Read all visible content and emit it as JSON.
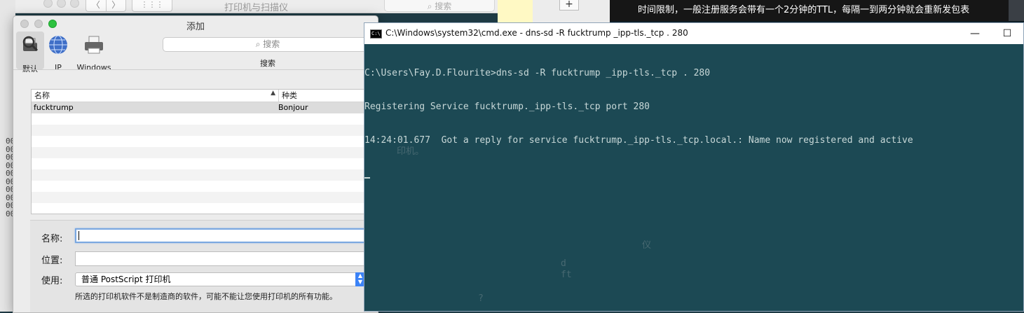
{
  "background": {
    "printers_window_title": "打印机与扫描仪",
    "printers_search_placeholder": "搜索",
    "nav_back": "〈",
    "nav_forward": "〉",
    "plus_button": "+",
    "left_gutter_lines": [
      "00",
      "00",
      "00",
      "00",
      "00",
      "00",
      "00",
      "00",
      "00",
      "00"
    ],
    "banner_text": "时间限制，一般注册服务会带有一个2分钟的TTL，每隔一到两分钟就会重新发包表",
    "ghost_text_1": "印机。",
    "ghost_text_2": "仪",
    "ghost_text_3": "d",
    "ghost_text_4": "ft",
    "ghost_text_5": "?"
  },
  "dialog": {
    "title": "添加",
    "toolbar": [
      {
        "label": "默认",
        "icon": "default-printer-icon"
      },
      {
        "label": "IP",
        "icon": "globe-icon"
      },
      {
        "label": "Windows",
        "icon": "windows-printer-icon"
      }
    ],
    "search_placeholder": "搜索",
    "search_caption": "搜索",
    "table": {
      "headers": [
        "名称",
        "种类"
      ],
      "rows": [
        {
          "name": "fucktrump",
          "kind": "Bonjour"
        }
      ]
    },
    "form": {
      "name_label": "名称:",
      "name_value": "",
      "location_label": "位置:",
      "location_value": "",
      "use_label": "使用:",
      "use_value": "普通 PostScript 打印机",
      "note": "所选的打印机软件不是制造商的软件，可能不能让您使用打印机的所有功能。"
    }
  },
  "cmd": {
    "title": "C:\\Windows\\system32\\cmd.exe - dns-sd  -R fucktrump _ipp-tls._tcp . 280",
    "minimize": "—",
    "maximize": "☐",
    "lines": [
      "C:\\Users\\Fay.D.Flourite>dns-sd -R fucktrump _ipp-tls._tcp . 280",
      "Registering Service fucktrump._ipp-tls._tcp port 280",
      "14:24:01.677  Got a reply for service fucktrump._ipp-tls._tcp.local.: Name now registered and active"
    ]
  }
}
